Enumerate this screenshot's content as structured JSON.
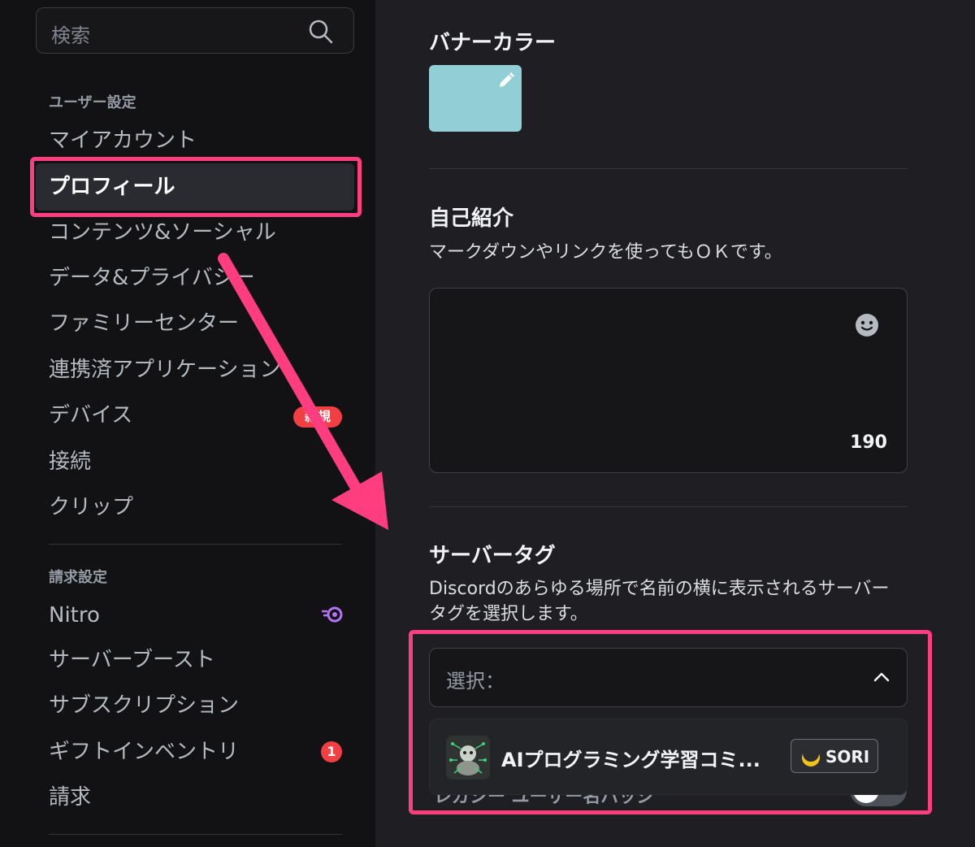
{
  "sidebar": {
    "search_placeholder": "検索",
    "section_user": "ユーザー設定",
    "items_user": [
      {
        "label": "マイアカウント"
      },
      {
        "label": "プロフィール"
      },
      {
        "label": "コンテンツ&ソーシャル"
      },
      {
        "label": "データ&プライバシー"
      },
      {
        "label": "ファミリーセンター"
      },
      {
        "label": "連携済アプリケーション"
      },
      {
        "label": "デバイス"
      },
      {
        "label": "接続"
      },
      {
        "label": "クリップ"
      }
    ],
    "device_badge": "新規",
    "section_billing": "請求設定",
    "items_billing": [
      {
        "label": "Nitro"
      },
      {
        "label": "サーバーブースト"
      },
      {
        "label": "サブスクリプション"
      },
      {
        "label": "ギフトインベントリ"
      },
      {
        "label": "請求"
      }
    ],
    "gift_badge": "1"
  },
  "main": {
    "banner_title": "バナーカラー",
    "banner_color": "#91ced6",
    "bio_title": "自己紹介",
    "bio_hint": "マークダウンやリンクを使ってもＯＫです。",
    "bio_remaining": "190",
    "server_tag_title": "サーバータグ",
    "server_tag_desc_line1": "Discordのあらゆる場所で名前の横に表示されるサーバー",
    "server_tag_desc_line2": "タグを選択します。",
    "select_label": "選択：",
    "option_name": "AIプログラミング学習コミ...",
    "option_tag": "SORI",
    "behind_text": "レガシー ユーザー名バッジ"
  },
  "colors": {
    "highlight": "#ff3d7f",
    "badge_red": "#f23f43",
    "nitro_purple": "#b473f5"
  }
}
